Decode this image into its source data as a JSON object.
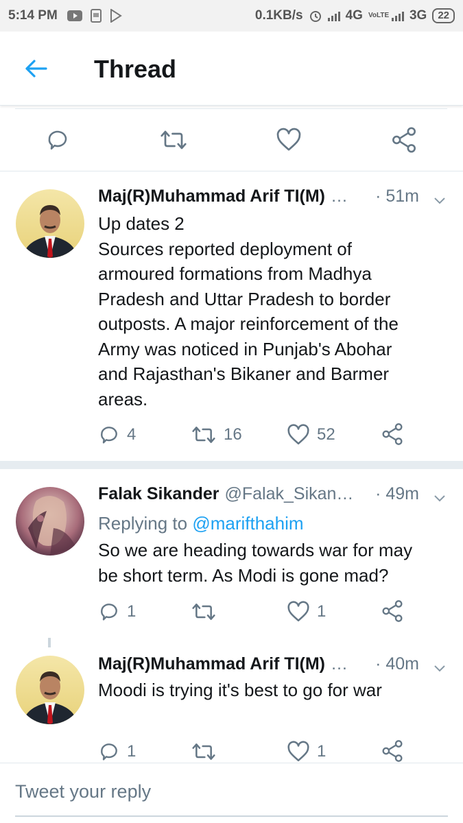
{
  "status_bar": {
    "time": "5:14 PM",
    "net_speed": "0.1KB/s",
    "net_4g": "4G",
    "volte": "VoLTE",
    "net_3g": "3G",
    "battery": "22"
  },
  "header": {
    "title": "Thread"
  },
  "top_actions": {
    "icons": [
      "reply-icon",
      "retweet-icon",
      "like-icon",
      "share-icon"
    ]
  },
  "tweets": [
    {
      "name": "Maj(R)Muhammad Arif TI(M)",
      "handle": "…",
      "time": "· 51m",
      "lines": [
        "Up dates 2",
        "Sources reported deployment of",
        "armoured formations from Madhya",
        "Pradesh and Uttar Pradesh to border",
        "outposts. A major reinforcement of the",
        "Army was noticed in Punjab's Abohar",
        "and Rajasthan's Bikaner and Barmer",
        "areas."
      ],
      "replies": "4",
      "retweets": "16",
      "likes": "52"
    },
    {
      "name": "Falak Sikander",
      "handle": "@Falak_Sikan…",
      "time": "· 49m",
      "replying_prefix": "Replying to",
      "replying_mention": "@marifthahim",
      "lines": [
        "So we are heading towards war for may",
        "be short term. As Modi is gone mad?"
      ],
      "replies": "1",
      "retweets": "",
      "likes": "1"
    },
    {
      "name": "Maj(R)Muhammad Arif TI(M)",
      "handle": "…",
      "time": "· 40m",
      "lines": [
        "Moodi is trying it's best to go for war"
      ],
      "replies": "1",
      "retweets": "",
      "likes": "1"
    }
  ],
  "reply_box": {
    "placeholder": "Tweet your reply"
  },
  "colors": {
    "accent": "#1da1f2",
    "secondary_text": "#657786",
    "divider": "#e1e8ed"
  }
}
